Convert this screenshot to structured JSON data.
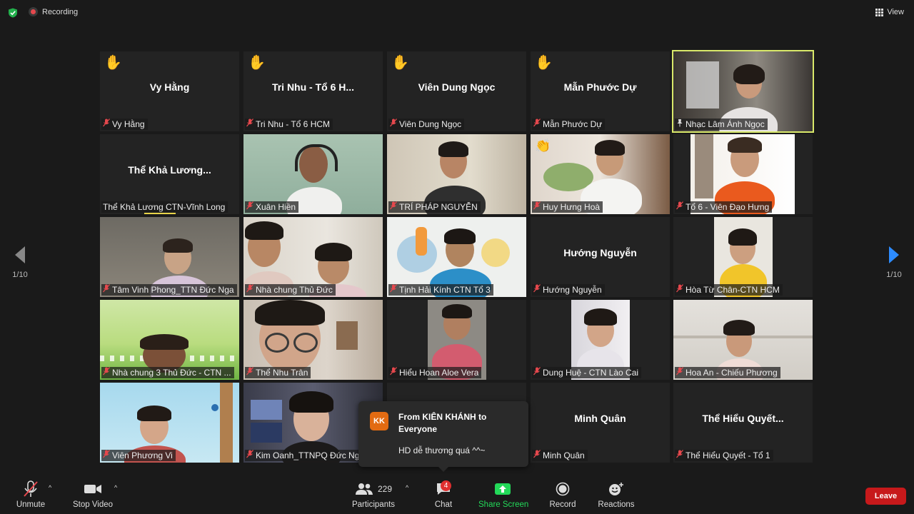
{
  "topbar": {
    "recording": "Recording",
    "view": "View"
  },
  "pagination": {
    "left": "1/10",
    "right": "1/10"
  },
  "tiles": [
    {
      "label": "Vy Hằng",
      "center": "Vy Hằng",
      "hand": "✋"
    },
    {
      "label": "Tri Nhu - Tổ 6 HCM",
      "center": "Tri Nhu - Tổ 6 H...",
      "hand": "✋"
    },
    {
      "label": "Viên Dung Ngọc",
      "center": "Viên Dung Ngọc",
      "hand": "✋"
    },
    {
      "label": "Mẫn Phước Dự",
      "center": "Mẫn Phước Dự",
      "hand": "✋"
    },
    {
      "label": "Nhạc Lâm Ánh Ngọc"
    },
    {
      "label": "Thể Khả Lương CTN-Vĩnh Long",
      "center": "Thể Khả Lương..."
    },
    {
      "label": "Xuân Hiền"
    },
    {
      "label": "TRÍ PHÁP NGUYỄN"
    },
    {
      "label": "Huy Hưng Hoà",
      "wave": "👏"
    },
    {
      "label": "Tổ 6 - Viên Đạo Hưng"
    },
    {
      "label": "Tâm Vinh Phong_TTN Đức Nga"
    },
    {
      "label": "Nhà chung Thủ Đức"
    },
    {
      "label": "Tịnh Hải Kính CTN Tổ 3"
    },
    {
      "label": "Hướng Nguyễn",
      "center": "Hướng Nguyễn"
    },
    {
      "label": "Hòa Từ Chân-CTN HCM"
    },
    {
      "label": "Nhà chung 3 Thủ Đức - CTN ..."
    },
    {
      "label": "Thể Nhu Trân"
    },
    {
      "label": "Hiểu Hoan Aloe Vera"
    },
    {
      "label": "Dung Huệ - CTN Lào Cai"
    },
    {
      "label": "Hoa An - Chiếu Phương"
    },
    {
      "label": "Viên Phương Vi"
    },
    {
      "label": "Kim Oanh_TTNPQ Đức Ng..."
    },
    {
      "label": ""
    },
    {
      "label": "Minh Quân",
      "center": "Minh Quân"
    },
    {
      "label": "Thể Hiểu Quyết - Tổ 1",
      "center": "Thể Hiểu Quyết..."
    }
  ],
  "chat_popup": {
    "avatar": "KK",
    "from": "From KIÊN KHÁNH to Everyone",
    "message": "HD dễ thương quá ^^~"
  },
  "toolbar": {
    "unmute": "Unmute",
    "stop_video": "Stop Video",
    "participants": "Participants",
    "participants_count": "229",
    "chat": "Chat",
    "chat_badge": "4",
    "share_screen": "Share Screen",
    "record": "Record",
    "reactions": "Reactions",
    "leave": "Leave"
  },
  "colors": {
    "active_speaker": "#d9e96a",
    "share_green": "#23d959",
    "leave_red": "#c7191b",
    "badge_red": "#e02f2f",
    "accent_blue": "#2d8cff"
  }
}
